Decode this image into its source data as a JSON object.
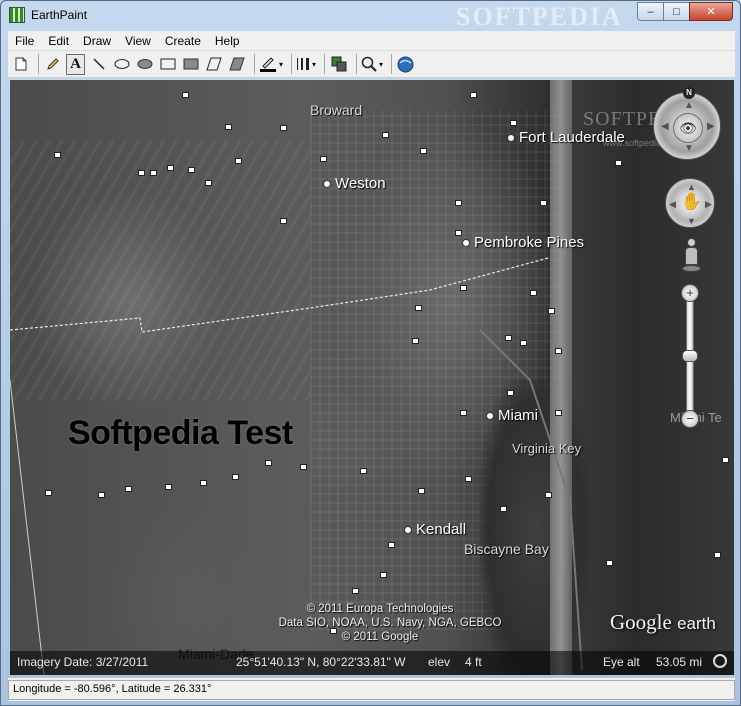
{
  "window": {
    "title": "EarthPaint",
    "watermark": "SOFTPEDIA",
    "controls": {
      "minimize": "–",
      "maximize": "□",
      "close": "✕"
    }
  },
  "menu": [
    "File",
    "Edit",
    "Draw",
    "View",
    "Create",
    "Help"
  ],
  "toolbar": {
    "icons": [
      "new-document-icon",
      "pencil-icon",
      "text-tool-icon",
      "line-icon",
      "ellipse-icon",
      "filled-ellipse-icon",
      "rectangle-icon",
      "filled-rectangle-icon",
      "polygon-icon",
      "filled-polygon-icon",
      "pen-color-icon",
      "line-width-icon",
      "layers-icon",
      "zoom-icon",
      "google-earth-icon"
    ],
    "text_tool_glyph": "A",
    "dropdown_glyph": "▾"
  },
  "map": {
    "places": {
      "fort_lauderdale": "Fort Lauderdale",
      "weston": "Weston",
      "pembroke_pines": "Pembroke Pines",
      "miami": "Miami",
      "kendall": "Kendall"
    },
    "areas": {
      "broward": "Broward",
      "virginia_key": "Virginia Key",
      "biscayne_bay": "Biscayne Bay",
      "miami_dade": "Miami-Dade"
    },
    "annotation_text": "Softpedia Test",
    "copyright_lines": [
      "© 2011 Europa Technologies",
      "Data SIO, NOAA, U.S. Navy, NGA, GEBCO",
      "© 2011 Google"
    ],
    "logo": {
      "google": "Google",
      "earth": "earth"
    },
    "overlay_watermark": "SOFTPEDIA",
    "overlay_watermark_url": "www.softpedia.com",
    "ghost_miami": "Miami Te",
    "status": {
      "imagery_date": "Imagery Date: 3/27/2011",
      "coords": "25°51'40.13\" N, 80°22'33.81\" W",
      "elev_label": "elev",
      "elev_value": "4 ft",
      "eye_alt_label": "Eye alt",
      "eye_alt_value": "53.05 mi"
    },
    "nav": {
      "north": "N",
      "zoom_in": "+",
      "zoom_out": "−",
      "zoom_level": 0.5
    }
  },
  "statusbar": {
    "coordinates": "Longitude = -80.596°, Latitude = 26.331°"
  },
  "colors": {
    "accent_close": "#c7442d",
    "map_dark": "#2b2b2b",
    "chrome": "#f0f0f0"
  }
}
